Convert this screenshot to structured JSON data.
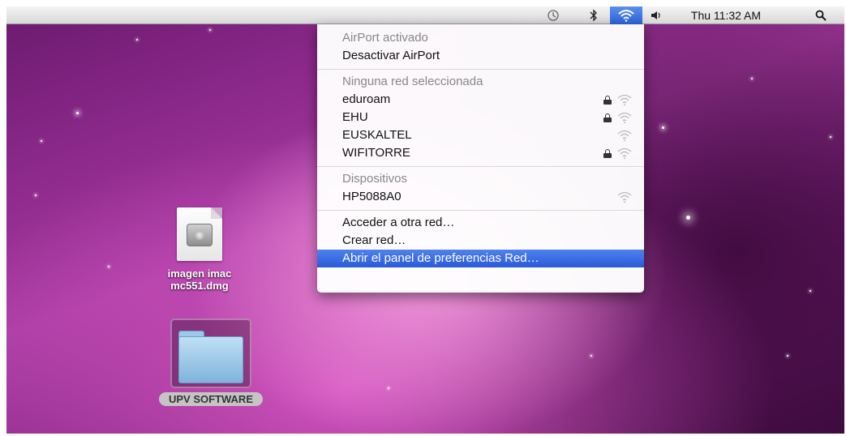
{
  "menubar": {
    "clock": "Thu 11:32 AM",
    "icons": [
      "time-machine-icon",
      "bluetooth-icon",
      "airport-icon",
      "volume-icon",
      "spotlight-icon"
    ]
  },
  "airport_menu": {
    "status": "AirPort activado",
    "toggle": "Desactivar AirPort",
    "networks_header": "Ninguna red seleccionada",
    "networks": [
      {
        "name": "eduroam",
        "locked": true
      },
      {
        "name": "EHU",
        "locked": true
      },
      {
        "name": "EUSKALTEL",
        "locked": false
      },
      {
        "name": "WIFITORRE",
        "locked": true
      }
    ],
    "devices_header": "Dispositivos",
    "devices": [
      {
        "name": "HP5088A0",
        "locked": false
      }
    ],
    "other_network": "Acceder a otra red…",
    "create_network": "Crear red…",
    "open_prefs": "Abrir el panel de preferencias Red…"
  },
  "desktop": {
    "dmg_label_line1": "imagen imac",
    "dmg_label_line2": "mc551.dmg",
    "folder_label": "UPV SOFTWARE"
  },
  "colors": {
    "selection": "#2f5fd9",
    "wallpaper": "#a83ba2"
  }
}
